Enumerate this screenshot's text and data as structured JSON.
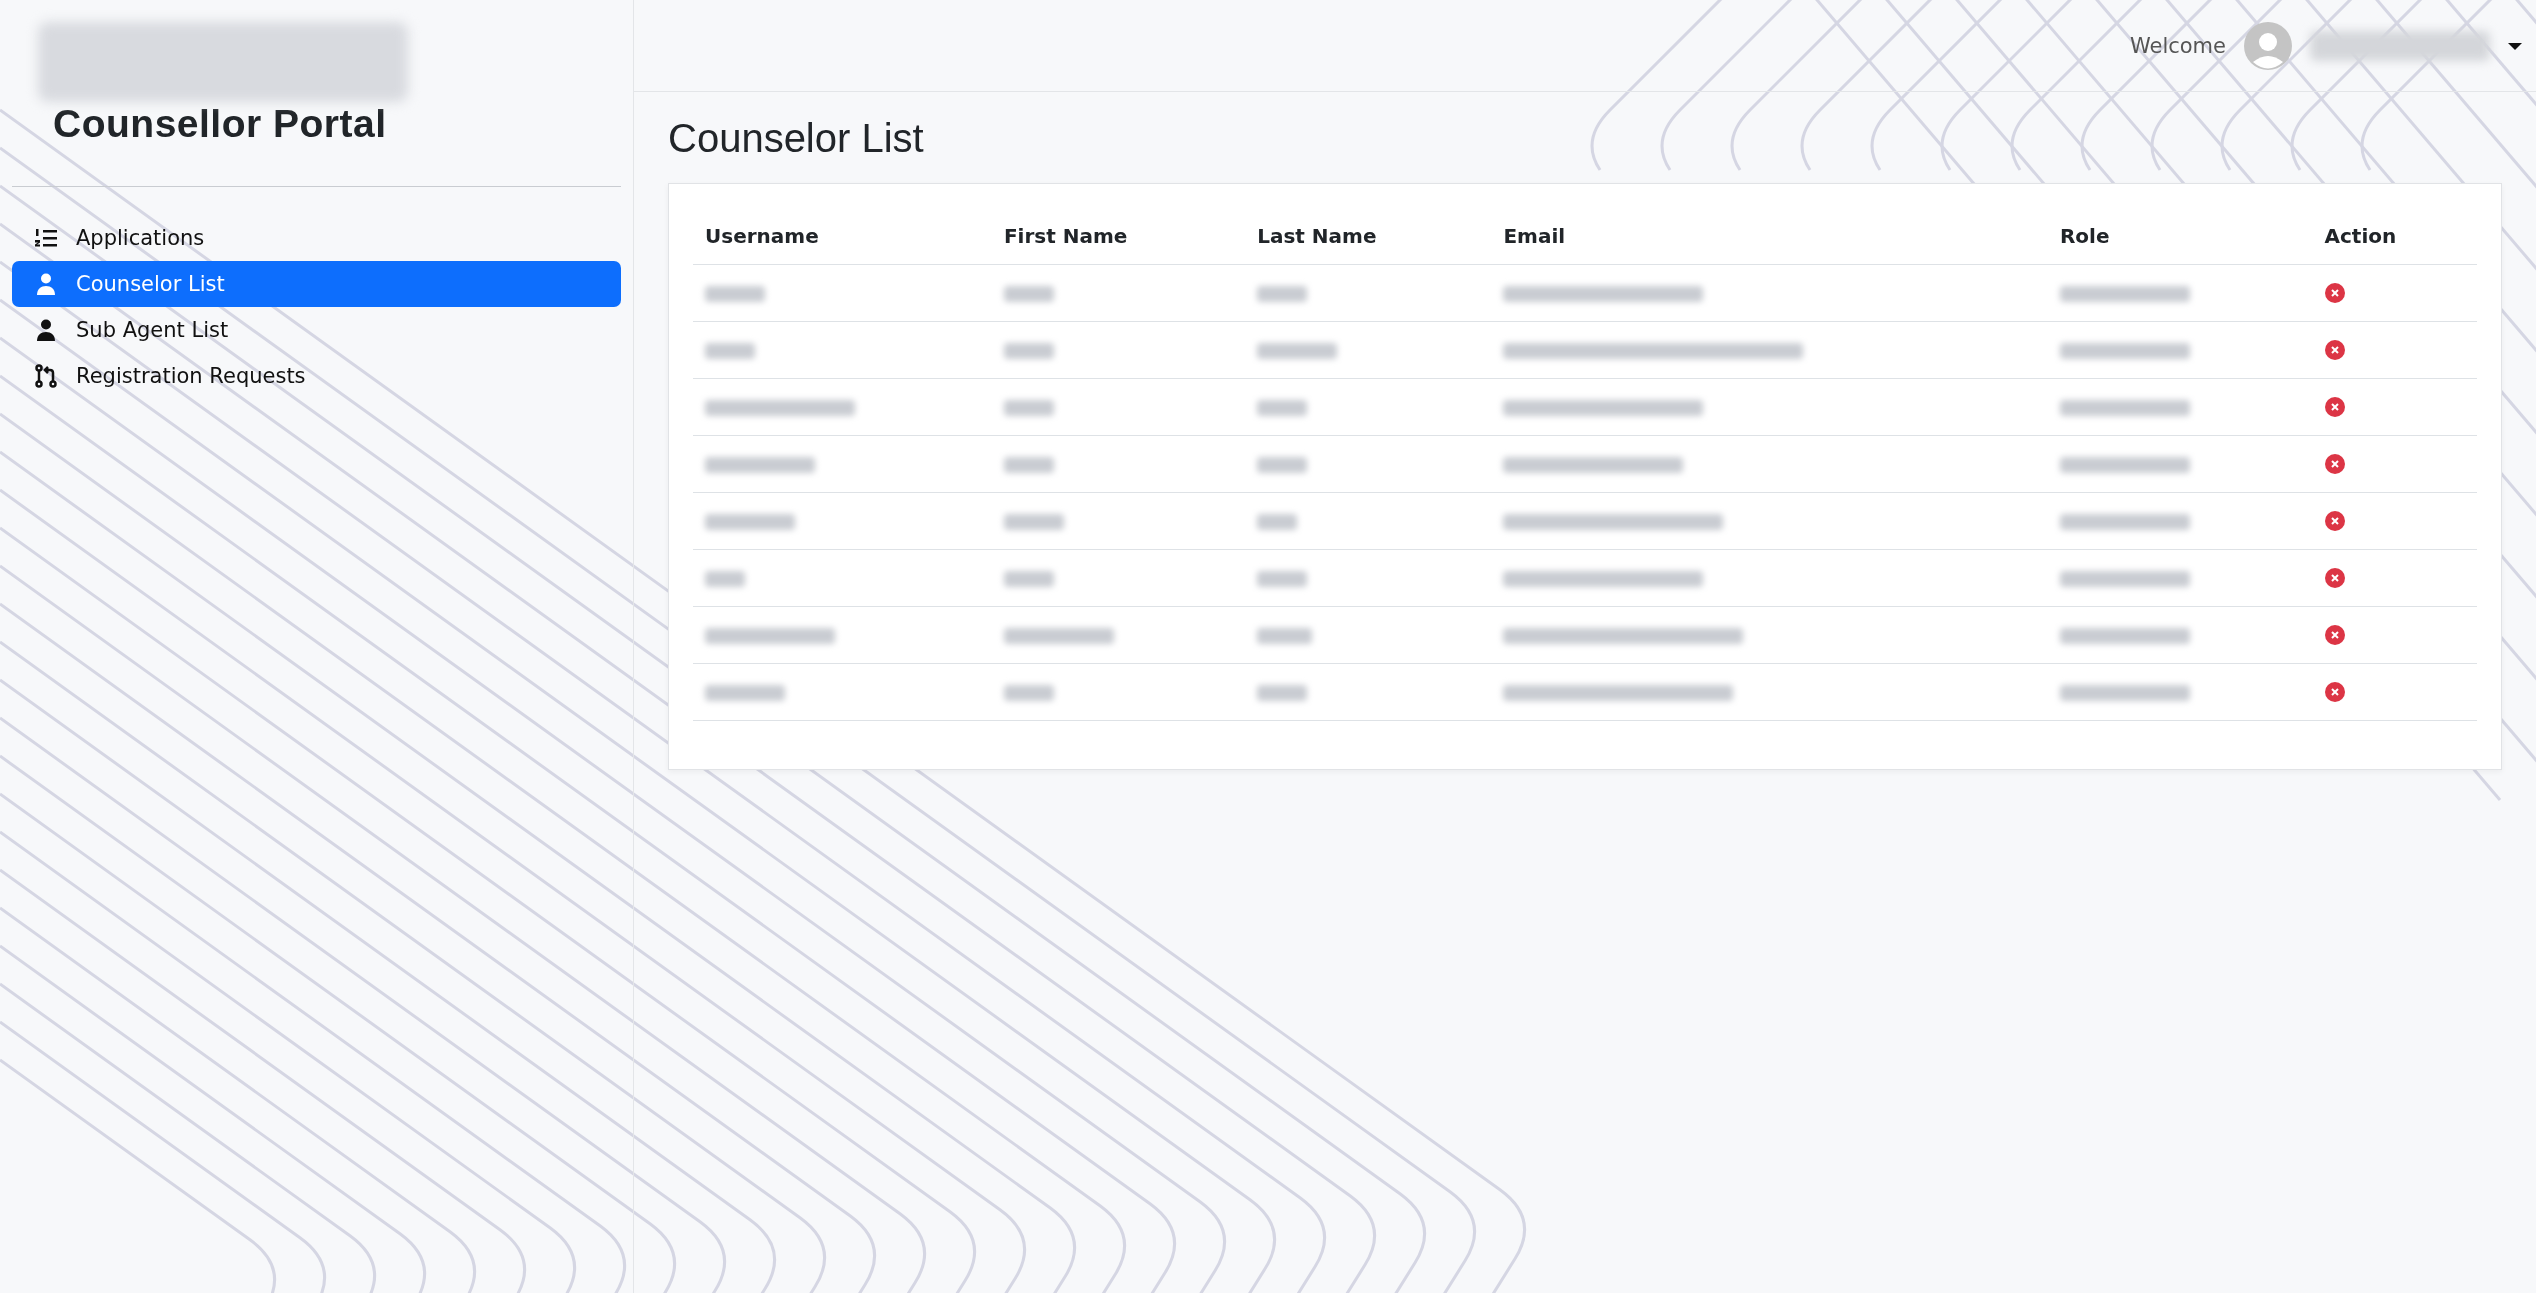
{
  "sidebar": {
    "title": "Counsellor Portal",
    "items": [
      {
        "label": "Applications",
        "kind": "list",
        "selected": false
      },
      {
        "label": "Counselor List",
        "kind": "user",
        "selected": true
      },
      {
        "label": "Sub Agent List",
        "kind": "user",
        "selected": false
      },
      {
        "label": "Registration Requests",
        "kind": "pull",
        "selected": false
      }
    ]
  },
  "header": {
    "greeting": "Welcome"
  },
  "page_title": "Counselor List",
  "table": {
    "columns": [
      "Username",
      "First Name",
      "Last Name",
      "Email",
      "Role",
      "Action"
    ],
    "rows": [
      {
        "kind": "redacted"
      },
      {
        "kind": "redacted"
      },
      {
        "kind": "redacted"
      },
      {
        "kind": "redacted"
      },
      {
        "kind": "redacted"
      },
      {
        "kind": "redacted"
      },
      {
        "kind": "redacted"
      },
      {
        "kind": "redacted"
      }
    ]
  }
}
